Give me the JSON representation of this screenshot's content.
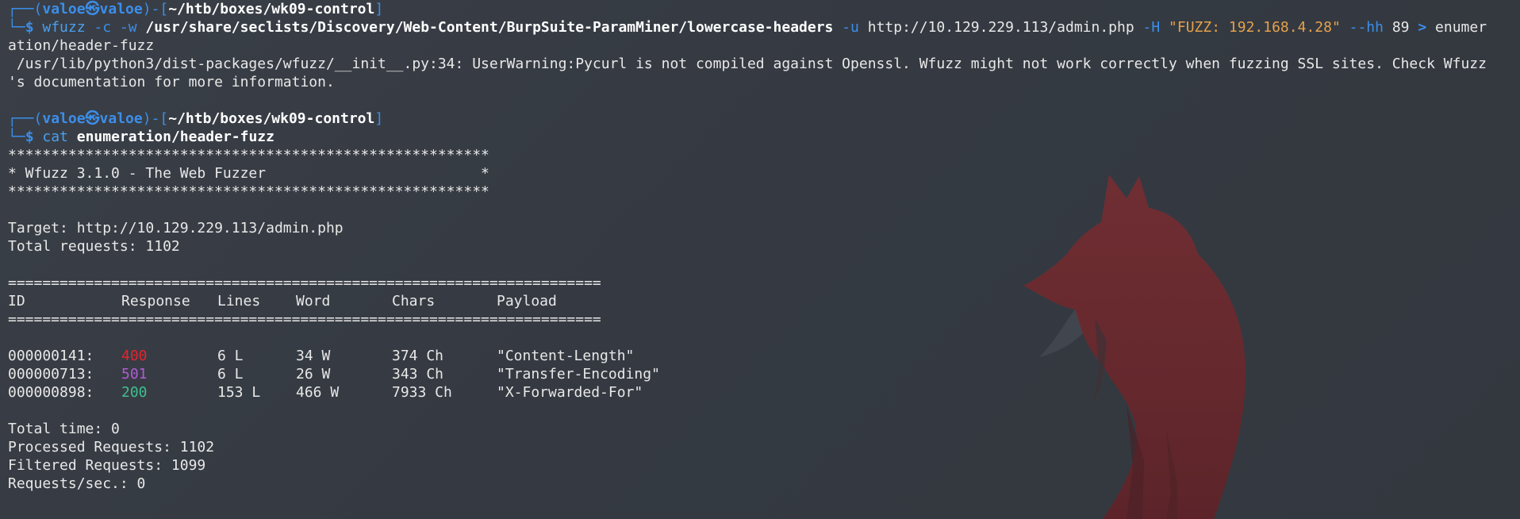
{
  "prompt1": {
    "corner_top": "┌──(",
    "user": "valoe",
    "skull": "㉿",
    "host": "valoe",
    "sep": ")-[",
    "path": "~/htb/boxes/wk09-control",
    "close": "]",
    "corner_bottom": "└─",
    "dollar": "$ "
  },
  "command1": {
    "binary": "wfuzz",
    "flags1": " -c -w ",
    "wordlist": "/usr/share/seclists/Discovery/Web-Content/BurpSuite-ParamMiner/lowercase-headers",
    "flag_u": " -u ",
    "url": "http://10.129.229.113/admin.php",
    "flag_h": " -H ",
    "header": "\"FUZZ: 192.168.4.28\"",
    "flag_hh": " --hh ",
    "hh_value": "89",
    "redirect": " > ",
    "outfile_part1": "enumer",
    "outfile_part2": "ation/header-fuzz"
  },
  "warning": {
    "line1": " /usr/lib/python3/dist-packages/wfuzz/__init__.py:34: UserWarning:Pycurl is not compiled against Openssl. Wfuzz might not work correctly when fuzzing SSL sites. Check Wfuzz",
    "line2": "'s documentation for more information."
  },
  "command2": {
    "binary": "cat",
    "file": "enumeration/header-fuzz"
  },
  "banner": {
    "stars": "********************************************************",
    "title": "* Wfuzz 3.1.0 - The Web Fuzzer                         *"
  },
  "target": "Target: http://10.129.229.113/admin.php",
  "total_requests": "Total requests: 1102",
  "separator": "=====================================================================",
  "table": {
    "headers": [
      "ID",
      "Response",
      "Lines",
      "Word",
      "Chars",
      "Payload"
    ],
    "rows": [
      {
        "id": "000000141:",
        "response": "400",
        "lines": "6 L",
        "word": "34 W",
        "chars": "374 Ch",
        "payload": "\"Content-Length\"",
        "color": "#e0262f"
      },
      {
        "id": "000000713:",
        "response": "501",
        "lines": "6 L",
        "word": "26 W",
        "chars": "343 Ch",
        "payload": "\"Transfer-Encoding\"",
        "color": "#b25ad6"
      },
      {
        "id": "000000898:",
        "response": "200",
        "lines": "153 L",
        "word": "466 W",
        "chars": "7933 Ch",
        "payload": "\"X-Forwarded-For\"",
        "color": "#3fbf8f"
      }
    ]
  },
  "summary": {
    "total_time": "Total time: 0",
    "processed": "Processed Requests: 1102",
    "filtered": "Filtered Requests: 1099",
    "rate": "Requests/sec.: 0"
  },
  "colors": {
    "background": "#373c44",
    "prompt_blue": "#3b8eea",
    "string_orange": "#e5a14b",
    "status_400": "#e0262f",
    "status_501": "#b25ad6",
    "status_200": "#3fbf8f",
    "fox": "#6e2a2e"
  },
  "background_art": "fox-silhouette-wallpaper"
}
